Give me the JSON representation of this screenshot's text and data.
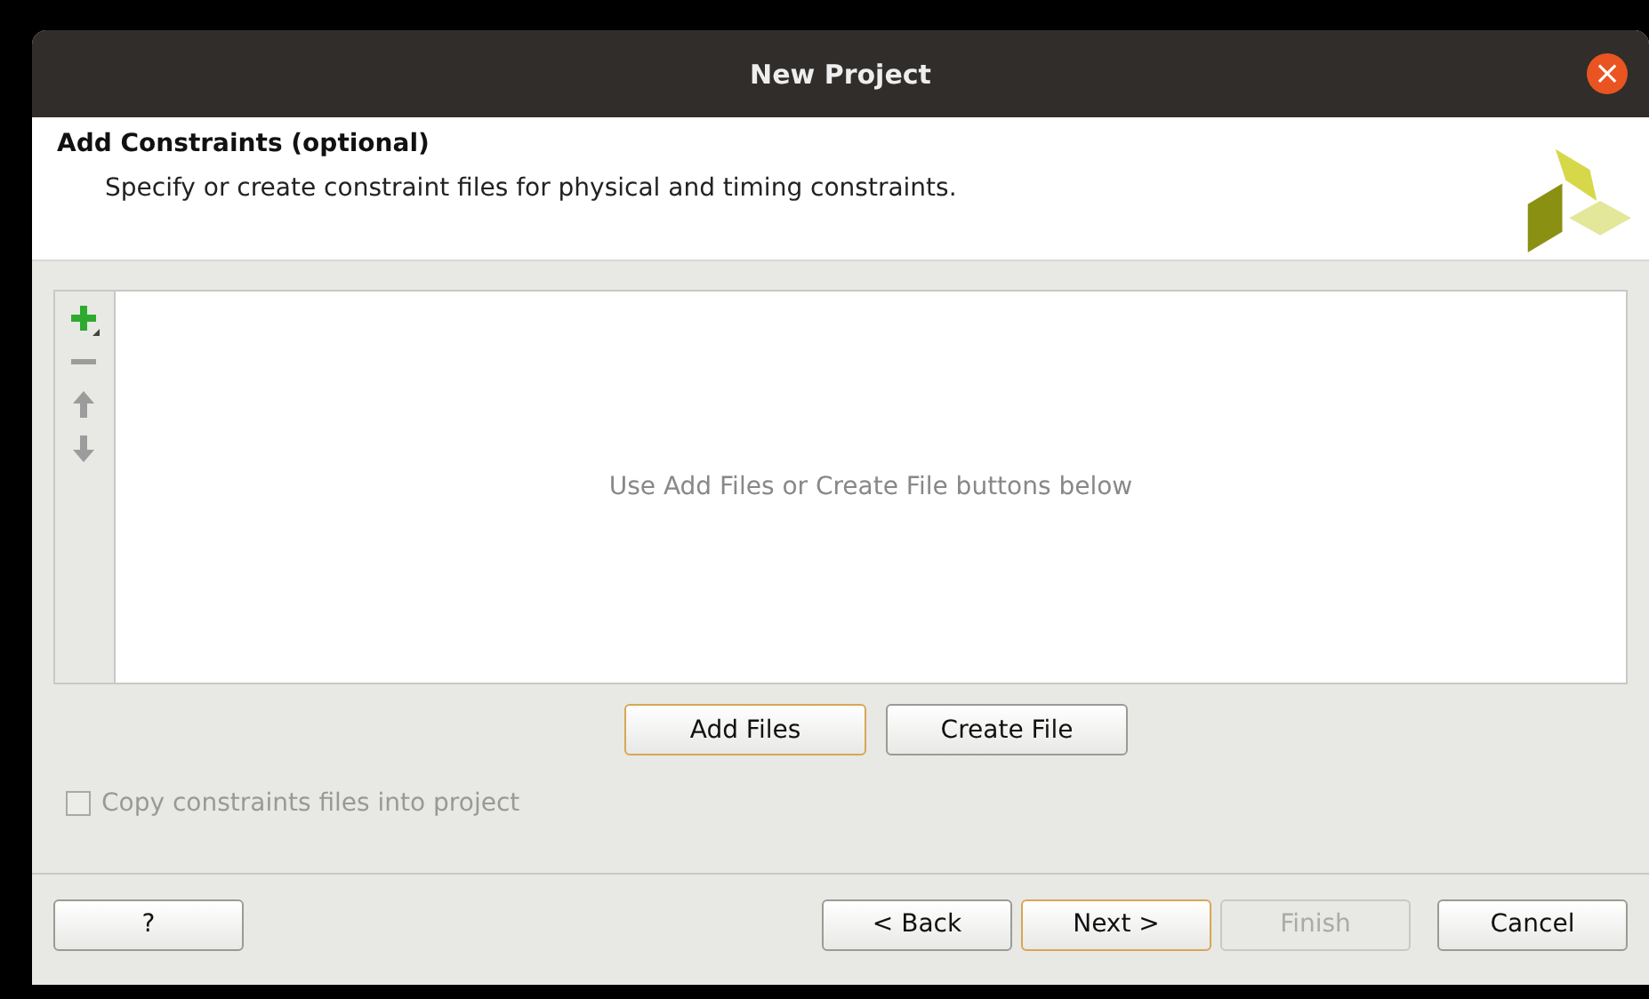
{
  "window": {
    "title": "New Project",
    "close": "×"
  },
  "header": {
    "title": "Add Constraints (optional)",
    "subtitle": "Specify or create constraint files for physical and timing constraints."
  },
  "file_list": {
    "empty_message": "Use Add Files or Create File buttons below",
    "toolbar": [
      {
        "kind": "add",
        "disabled": false
      },
      {
        "kind": "remove",
        "disabled": true
      },
      {
        "kind": "up",
        "disabled": true
      },
      {
        "kind": "down",
        "disabled": true
      }
    ]
  },
  "actions": [
    {
      "label": "Add Files",
      "default": true
    },
    {
      "label": "Create File",
      "default": false
    }
  ],
  "copy_option": {
    "label": "Copy constraints files into project",
    "checked": false,
    "disabled": true
  },
  "footer": {
    "help": "?",
    "buttons": [
      {
        "label": "< Back",
        "default": false,
        "disabled": false
      },
      {
        "label": "Next >",
        "default": true,
        "disabled": false
      },
      {
        "label": "Finish",
        "default": false,
        "disabled": true
      },
      {
        "label": "Cancel",
        "default": false,
        "disabled": false
      }
    ]
  }
}
